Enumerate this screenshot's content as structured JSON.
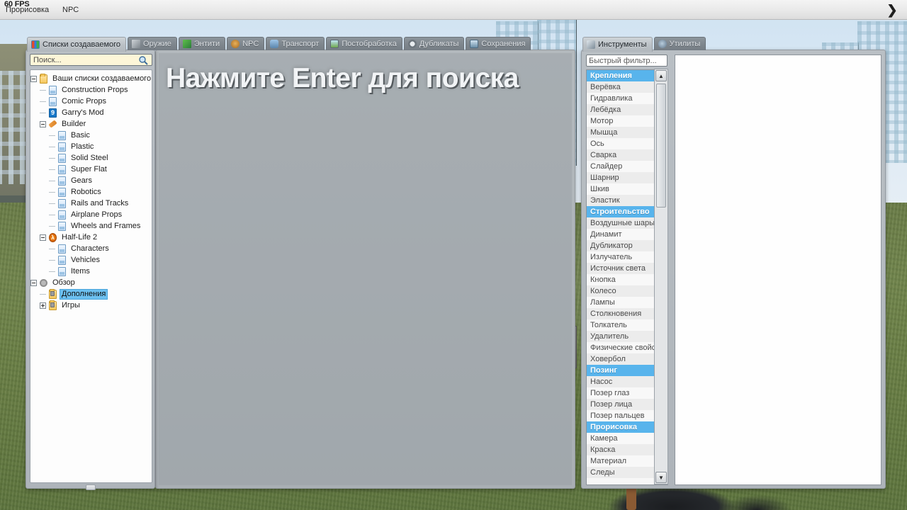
{
  "topbar": {
    "fps": "60 FPS",
    "menus": [
      {
        "label": "Прорисовка",
        "name": "menu-render"
      },
      {
        "label": "NPC",
        "name": "menu-npc"
      }
    ],
    "arrow_icon": "chevron-right-icon",
    "arrow_glyph": "❯"
  },
  "left_panel": {
    "tabs": [
      {
        "label": "Списки создаваемого",
        "icon": "grid-icon",
        "active": true
      },
      {
        "label": "Оружие",
        "icon": "weapon-icon",
        "active": false
      },
      {
        "label": "Энтити",
        "icon": "entity-icon",
        "active": false
      },
      {
        "label": "NPC",
        "icon": "npc-face-icon",
        "active": false
      },
      {
        "label": "Транспорт",
        "icon": "vehicle-icon",
        "active": false
      },
      {
        "label": "Постобработка",
        "icon": "postprocess-icon",
        "active": false
      },
      {
        "label": "Дубликаты",
        "icon": "duplicator-icon",
        "active": false
      },
      {
        "label": "Сохранения",
        "icon": "save-icon",
        "active": false
      }
    ],
    "search": {
      "placeholder": "Поиск...",
      "value": "Поиск...",
      "icon": "magnifier-icon"
    },
    "tree": [
      {
        "label": "Ваши списки создаваемого",
        "icon": "folder-icon",
        "depth": 0,
        "expander": "minus",
        "selected": false
      },
      {
        "label": "Construction Props",
        "icon": "doc-icon",
        "depth": 1,
        "expander": "none",
        "selected": false
      },
      {
        "label": "Comic Props",
        "icon": "doc-icon",
        "depth": 1,
        "expander": "none",
        "selected": false
      },
      {
        "label": "Garry's Mod",
        "icon": "gmod-icon",
        "depth": 1,
        "expander": "none",
        "selected": false
      },
      {
        "label": "Builder",
        "icon": "wrench-icon",
        "depth": 1,
        "expander": "minus",
        "selected": false
      },
      {
        "label": "Basic",
        "icon": "doc-icon",
        "depth": 2,
        "expander": "none",
        "selected": false
      },
      {
        "label": "Plastic",
        "icon": "doc-icon",
        "depth": 2,
        "expander": "none",
        "selected": false
      },
      {
        "label": "Solid Steel",
        "icon": "doc-icon",
        "depth": 2,
        "expander": "none",
        "selected": false
      },
      {
        "label": "Super Flat",
        "icon": "doc-icon",
        "depth": 2,
        "expander": "none",
        "selected": false
      },
      {
        "label": "Gears",
        "icon": "doc-icon",
        "depth": 2,
        "expander": "none",
        "selected": false
      },
      {
        "label": "Robotics",
        "icon": "doc-icon",
        "depth": 2,
        "expander": "none",
        "selected": false
      },
      {
        "label": "Rails and Tracks",
        "icon": "doc-icon",
        "depth": 2,
        "expander": "none",
        "selected": false
      },
      {
        "label": "Airplane Props",
        "icon": "doc-icon",
        "depth": 2,
        "expander": "none",
        "selected": false
      },
      {
        "label": "Wheels and Frames",
        "icon": "doc-icon",
        "depth": 2,
        "expander": "none",
        "selected": false
      },
      {
        "label": "Half-Life 2",
        "icon": "hl2-icon",
        "depth": 1,
        "expander": "minus",
        "selected": false
      },
      {
        "label": "Characters",
        "icon": "doc-icon",
        "depth": 2,
        "expander": "none",
        "selected": false
      },
      {
        "label": "Vehicles",
        "icon": "doc-icon",
        "depth": 2,
        "expander": "none",
        "selected": false
      },
      {
        "label": "Items",
        "icon": "doc-icon",
        "depth": 2,
        "expander": "none",
        "selected": false
      },
      {
        "label": "Обзор",
        "icon": "gear-icon",
        "depth": 0,
        "expander": "minus",
        "selected": false
      },
      {
        "label": "Дополнения",
        "icon": "folder-lock-icon",
        "depth": 1,
        "expander": "none",
        "selected": true
      },
      {
        "label": "Игры",
        "icon": "folder-lock-icon",
        "depth": 1,
        "expander": "plus",
        "selected": false
      }
    ]
  },
  "center": {
    "hint": "Нажмите Enter для поиска"
  },
  "right_panel": {
    "tabs": [
      {
        "label": "Инструменты",
        "icon": "tool-icon",
        "active": true
      },
      {
        "label": "Утилиты",
        "icon": "utility-icon",
        "active": false
      }
    ],
    "filter": {
      "placeholder": "Быстрый фильтр...",
      "value": "Быстрый фильтр...",
      "name": "quick-filter-input"
    },
    "tools": [
      {
        "label": "Крепления",
        "type": "header"
      },
      {
        "label": "Верёвка",
        "type": "item"
      },
      {
        "label": "Гидравлика",
        "type": "item"
      },
      {
        "label": "Лебёдка",
        "type": "item"
      },
      {
        "label": "Мотор",
        "type": "item"
      },
      {
        "label": "Мышца",
        "type": "item"
      },
      {
        "label": "Ось",
        "type": "item"
      },
      {
        "label": "Сварка",
        "type": "item"
      },
      {
        "label": "Слайдер",
        "type": "item"
      },
      {
        "label": "Шарнир",
        "type": "item"
      },
      {
        "label": "Шкив",
        "type": "item"
      },
      {
        "label": "Эластик",
        "type": "item"
      },
      {
        "label": "Строительство",
        "type": "header"
      },
      {
        "label": "Воздушные шары",
        "type": "item"
      },
      {
        "label": "Динамит",
        "type": "item"
      },
      {
        "label": "Дубликатор",
        "type": "item"
      },
      {
        "label": "Излучатель",
        "type": "item"
      },
      {
        "label": "Источник света",
        "type": "item"
      },
      {
        "label": "Кнопка",
        "type": "item"
      },
      {
        "label": "Колесо",
        "type": "item"
      },
      {
        "label": "Лампы",
        "type": "item"
      },
      {
        "label": "Столкновения",
        "type": "item"
      },
      {
        "label": "Толкатель",
        "type": "item"
      },
      {
        "label": "Удалитель",
        "type": "item"
      },
      {
        "label": "Физические свойс...",
        "type": "item"
      },
      {
        "label": "Ховербол",
        "type": "item"
      },
      {
        "label": "Позинг",
        "type": "header"
      },
      {
        "label": "Насос",
        "type": "item"
      },
      {
        "label": "Позер глаз",
        "type": "item"
      },
      {
        "label": "Позер лица",
        "type": "item"
      },
      {
        "label": "Позер пальцев",
        "type": "item"
      },
      {
        "label": "Прорисовка",
        "type": "header"
      },
      {
        "label": "Камера",
        "type": "item"
      },
      {
        "label": "Краска",
        "type": "item"
      },
      {
        "label": "Материал",
        "type": "item"
      },
      {
        "label": "Следы",
        "type": "item"
      }
    ],
    "scrollbar": {
      "up_glyph": "▲",
      "down_glyph": "▼"
    }
  },
  "colors": {
    "accent": "#58b4ec",
    "selection": "#6cc0f0",
    "panel": "#b9bfc4",
    "tab_inactive": "#858d94",
    "search_field": "#fdf6d8"
  }
}
